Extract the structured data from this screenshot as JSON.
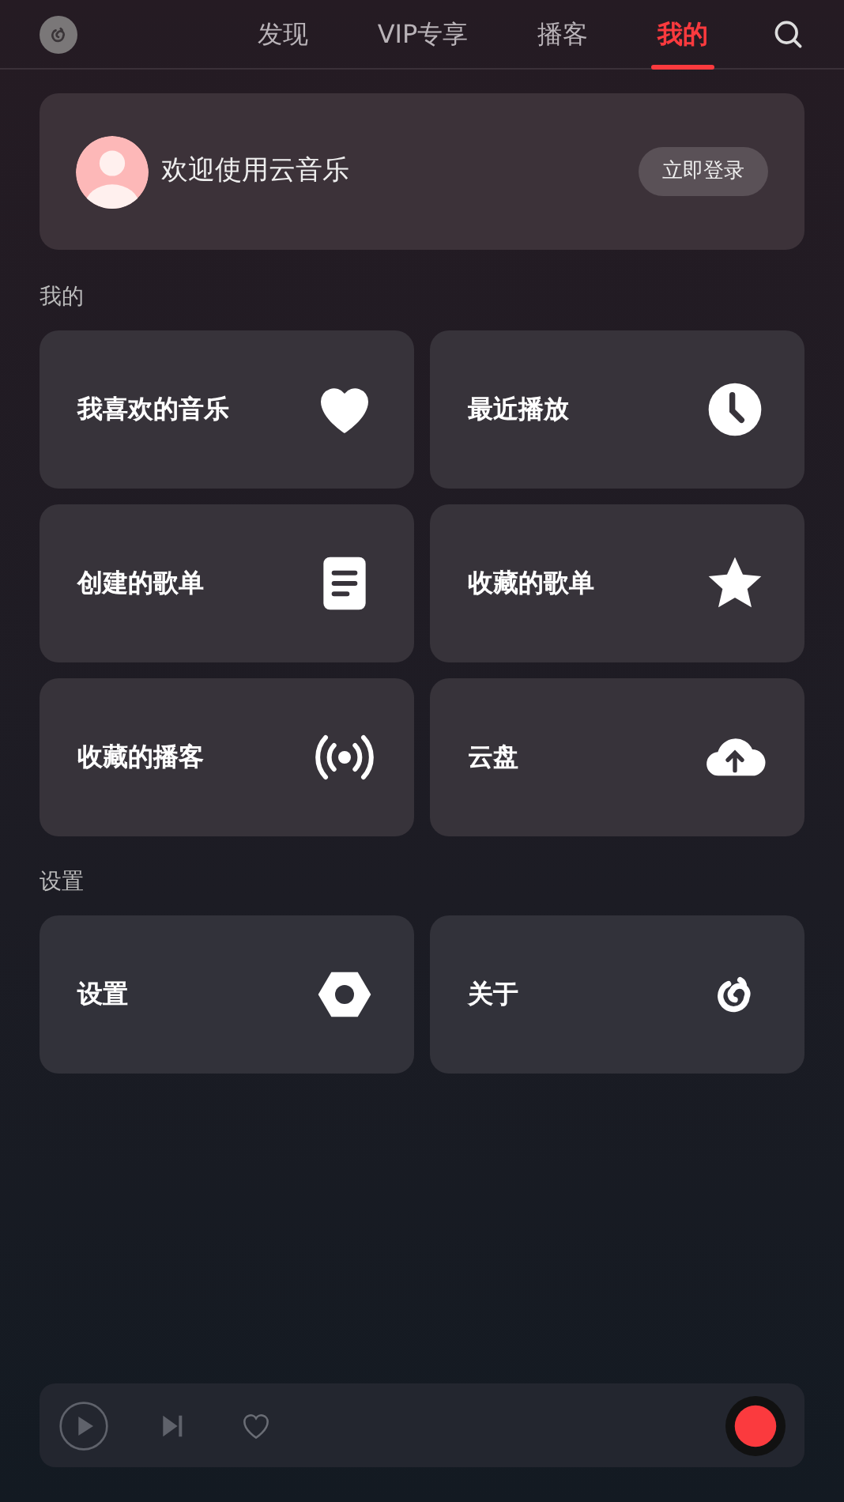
{
  "tabs": [
    {
      "label": "发现",
      "selected": false
    },
    {
      "label": "VIP专享",
      "selected": false
    },
    {
      "label": "播客",
      "selected": false
    },
    {
      "label": "我的",
      "selected": true
    }
  ],
  "login_card": {
    "greeting": "欢迎使用云音乐",
    "button": "立即登录"
  },
  "sections": [
    {
      "title": "我的",
      "tiles": [
        {
          "label": "我喜欢的音乐"
        },
        {
          "label": "最近播放"
        },
        {
          "label": "创建的歌单"
        },
        {
          "label": "收藏的歌单"
        },
        {
          "label": "收藏的播客"
        },
        {
          "label": "云盘"
        }
      ]
    },
    {
      "title": "设置",
      "tiles": [
        {
          "label": "设置"
        },
        {
          "label": "关于"
        }
      ]
    }
  ]
}
